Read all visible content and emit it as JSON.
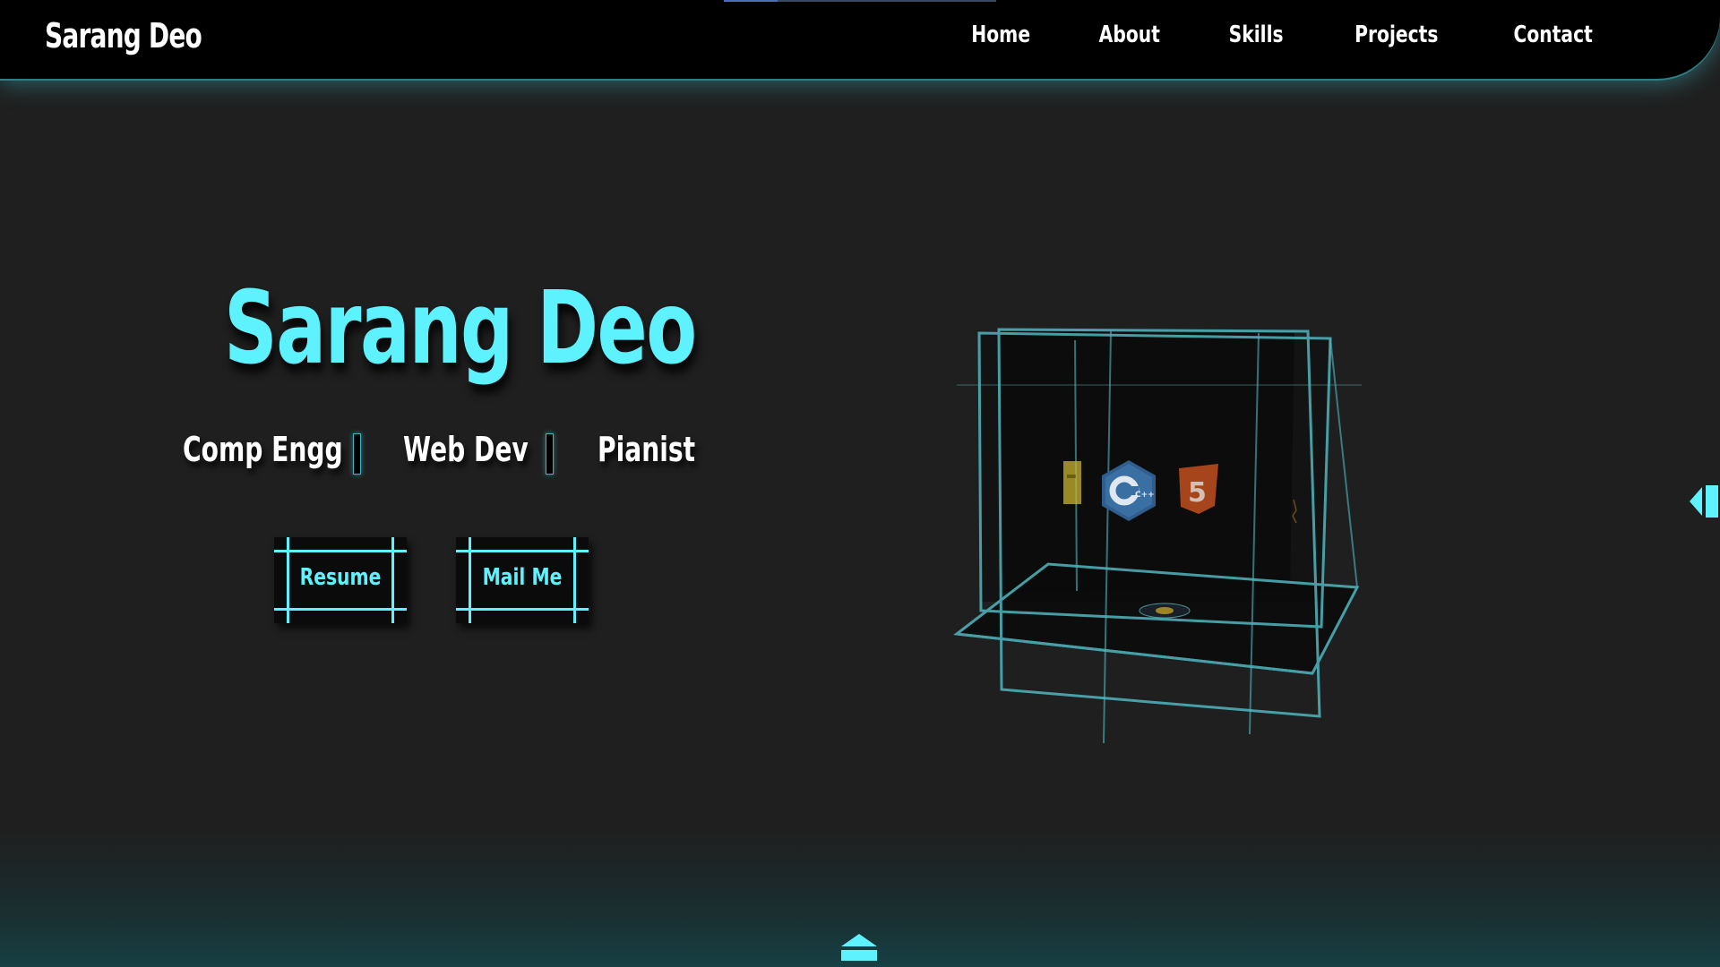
{
  "nav": {
    "brand": "Sarang Deo",
    "links": [
      {
        "label": "Home"
      },
      {
        "label": "About"
      },
      {
        "label": "Skills"
      },
      {
        "label": "Projects"
      },
      {
        "label": "Contact"
      }
    ]
  },
  "hero": {
    "title": "Sarang Deo",
    "roles": [
      "Comp Engg",
      "Web Dev",
      "Pianist"
    ],
    "buttons": {
      "resume_label": "Resume",
      "mail_label": "Mail Me"
    }
  },
  "cube": {
    "icons": [
      "js-icon",
      "cpp-icon",
      "html5-icon",
      "python-icon"
    ],
    "cpp_text": "C++",
    "html_text": "5"
  },
  "colors": {
    "accent": "#5ef2ff",
    "background": "#1f1f1f",
    "navbar": "#000000",
    "cube_edge": "#4fb7c0"
  },
  "icons": {
    "side_toggle": "sidebar-toggle-icon",
    "scroll_top": "eject-up-icon"
  }
}
